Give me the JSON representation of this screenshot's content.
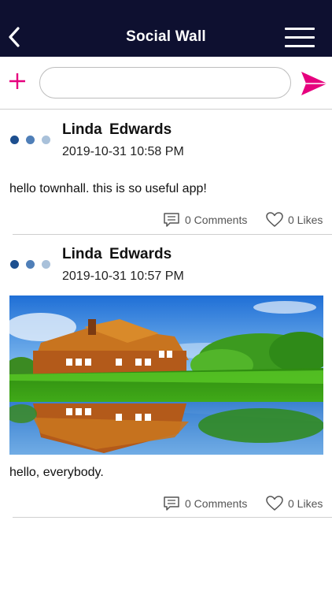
{
  "header": {
    "title": "Social Wall"
  },
  "composer": {
    "placeholder": ""
  },
  "posts": [
    {
      "author": "Linda  Edwards",
      "time": "2019-10-31 10:58 PM",
      "text": "hello townhall. this is so useful app!",
      "comments": "0 Comments",
      "likes": "0 Likes"
    },
    {
      "author": "Linda  Edwards",
      "time": "2019-10-31 10:57 PM",
      "text": "hello, everybody.",
      "comments": "0 Comments",
      "likes": "0 Likes"
    }
  ],
  "colors": {
    "header_bg": "#0e1030",
    "accent_pink": "#e6007e",
    "dot_dark": "#1d4f8f",
    "dot_mid": "#4f7fb8",
    "dot_light": "#a9c1da"
  }
}
